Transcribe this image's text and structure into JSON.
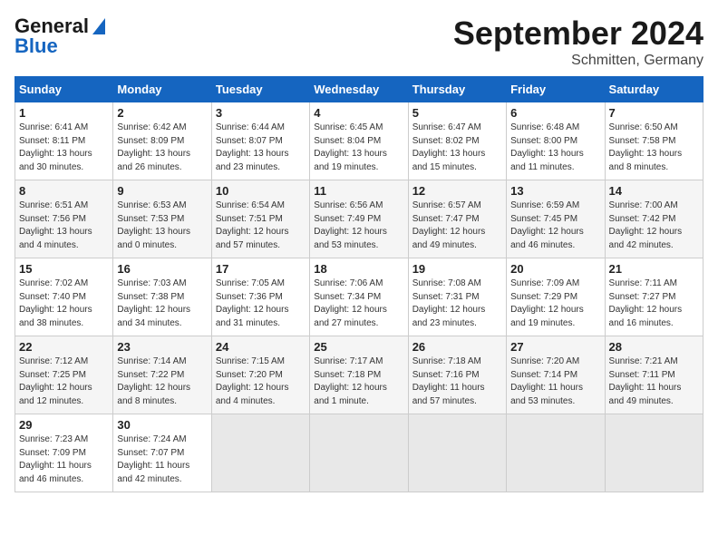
{
  "logo": {
    "line1": "General",
    "line2": "Blue"
  },
  "title": "September 2024",
  "location": "Schmitten, Germany",
  "days_of_week": [
    "Sunday",
    "Monday",
    "Tuesday",
    "Wednesday",
    "Thursday",
    "Friday",
    "Saturday"
  ],
  "weeks": [
    [
      {
        "day": "1",
        "info": "Sunrise: 6:41 AM\nSunset: 8:11 PM\nDaylight: 13 hours\nand 30 minutes."
      },
      {
        "day": "2",
        "info": "Sunrise: 6:42 AM\nSunset: 8:09 PM\nDaylight: 13 hours\nand 26 minutes."
      },
      {
        "day": "3",
        "info": "Sunrise: 6:44 AM\nSunset: 8:07 PM\nDaylight: 13 hours\nand 23 minutes."
      },
      {
        "day": "4",
        "info": "Sunrise: 6:45 AM\nSunset: 8:04 PM\nDaylight: 13 hours\nand 19 minutes."
      },
      {
        "day": "5",
        "info": "Sunrise: 6:47 AM\nSunset: 8:02 PM\nDaylight: 13 hours\nand 15 minutes."
      },
      {
        "day": "6",
        "info": "Sunrise: 6:48 AM\nSunset: 8:00 PM\nDaylight: 13 hours\nand 11 minutes."
      },
      {
        "day": "7",
        "info": "Sunrise: 6:50 AM\nSunset: 7:58 PM\nDaylight: 13 hours\nand 8 minutes."
      }
    ],
    [
      {
        "day": "8",
        "info": "Sunrise: 6:51 AM\nSunset: 7:56 PM\nDaylight: 13 hours\nand 4 minutes."
      },
      {
        "day": "9",
        "info": "Sunrise: 6:53 AM\nSunset: 7:53 PM\nDaylight: 13 hours\nand 0 minutes."
      },
      {
        "day": "10",
        "info": "Sunrise: 6:54 AM\nSunset: 7:51 PM\nDaylight: 12 hours\nand 57 minutes."
      },
      {
        "day": "11",
        "info": "Sunrise: 6:56 AM\nSunset: 7:49 PM\nDaylight: 12 hours\nand 53 minutes."
      },
      {
        "day": "12",
        "info": "Sunrise: 6:57 AM\nSunset: 7:47 PM\nDaylight: 12 hours\nand 49 minutes."
      },
      {
        "day": "13",
        "info": "Sunrise: 6:59 AM\nSunset: 7:45 PM\nDaylight: 12 hours\nand 46 minutes."
      },
      {
        "day": "14",
        "info": "Sunrise: 7:00 AM\nSunset: 7:42 PM\nDaylight: 12 hours\nand 42 minutes."
      }
    ],
    [
      {
        "day": "15",
        "info": "Sunrise: 7:02 AM\nSunset: 7:40 PM\nDaylight: 12 hours\nand 38 minutes."
      },
      {
        "day": "16",
        "info": "Sunrise: 7:03 AM\nSunset: 7:38 PM\nDaylight: 12 hours\nand 34 minutes."
      },
      {
        "day": "17",
        "info": "Sunrise: 7:05 AM\nSunset: 7:36 PM\nDaylight: 12 hours\nand 31 minutes."
      },
      {
        "day": "18",
        "info": "Sunrise: 7:06 AM\nSunset: 7:34 PM\nDaylight: 12 hours\nand 27 minutes."
      },
      {
        "day": "19",
        "info": "Sunrise: 7:08 AM\nSunset: 7:31 PM\nDaylight: 12 hours\nand 23 minutes."
      },
      {
        "day": "20",
        "info": "Sunrise: 7:09 AM\nSunset: 7:29 PM\nDaylight: 12 hours\nand 19 minutes."
      },
      {
        "day": "21",
        "info": "Sunrise: 7:11 AM\nSunset: 7:27 PM\nDaylight: 12 hours\nand 16 minutes."
      }
    ],
    [
      {
        "day": "22",
        "info": "Sunrise: 7:12 AM\nSunset: 7:25 PM\nDaylight: 12 hours\nand 12 minutes."
      },
      {
        "day": "23",
        "info": "Sunrise: 7:14 AM\nSunset: 7:22 PM\nDaylight: 12 hours\nand 8 minutes."
      },
      {
        "day": "24",
        "info": "Sunrise: 7:15 AM\nSunset: 7:20 PM\nDaylight: 12 hours\nand 4 minutes."
      },
      {
        "day": "25",
        "info": "Sunrise: 7:17 AM\nSunset: 7:18 PM\nDaylight: 12 hours\nand 1 minute."
      },
      {
        "day": "26",
        "info": "Sunrise: 7:18 AM\nSunset: 7:16 PM\nDaylight: 11 hours\nand 57 minutes."
      },
      {
        "day": "27",
        "info": "Sunrise: 7:20 AM\nSunset: 7:14 PM\nDaylight: 11 hours\nand 53 minutes."
      },
      {
        "day": "28",
        "info": "Sunrise: 7:21 AM\nSunset: 7:11 PM\nDaylight: 11 hours\nand 49 minutes."
      }
    ],
    [
      {
        "day": "29",
        "info": "Sunrise: 7:23 AM\nSunset: 7:09 PM\nDaylight: 11 hours\nand 46 minutes."
      },
      {
        "day": "30",
        "info": "Sunrise: 7:24 AM\nSunset: 7:07 PM\nDaylight: 11 hours\nand 42 minutes."
      },
      {
        "day": "",
        "info": ""
      },
      {
        "day": "",
        "info": ""
      },
      {
        "day": "",
        "info": ""
      },
      {
        "day": "",
        "info": ""
      },
      {
        "day": "",
        "info": ""
      }
    ]
  ]
}
